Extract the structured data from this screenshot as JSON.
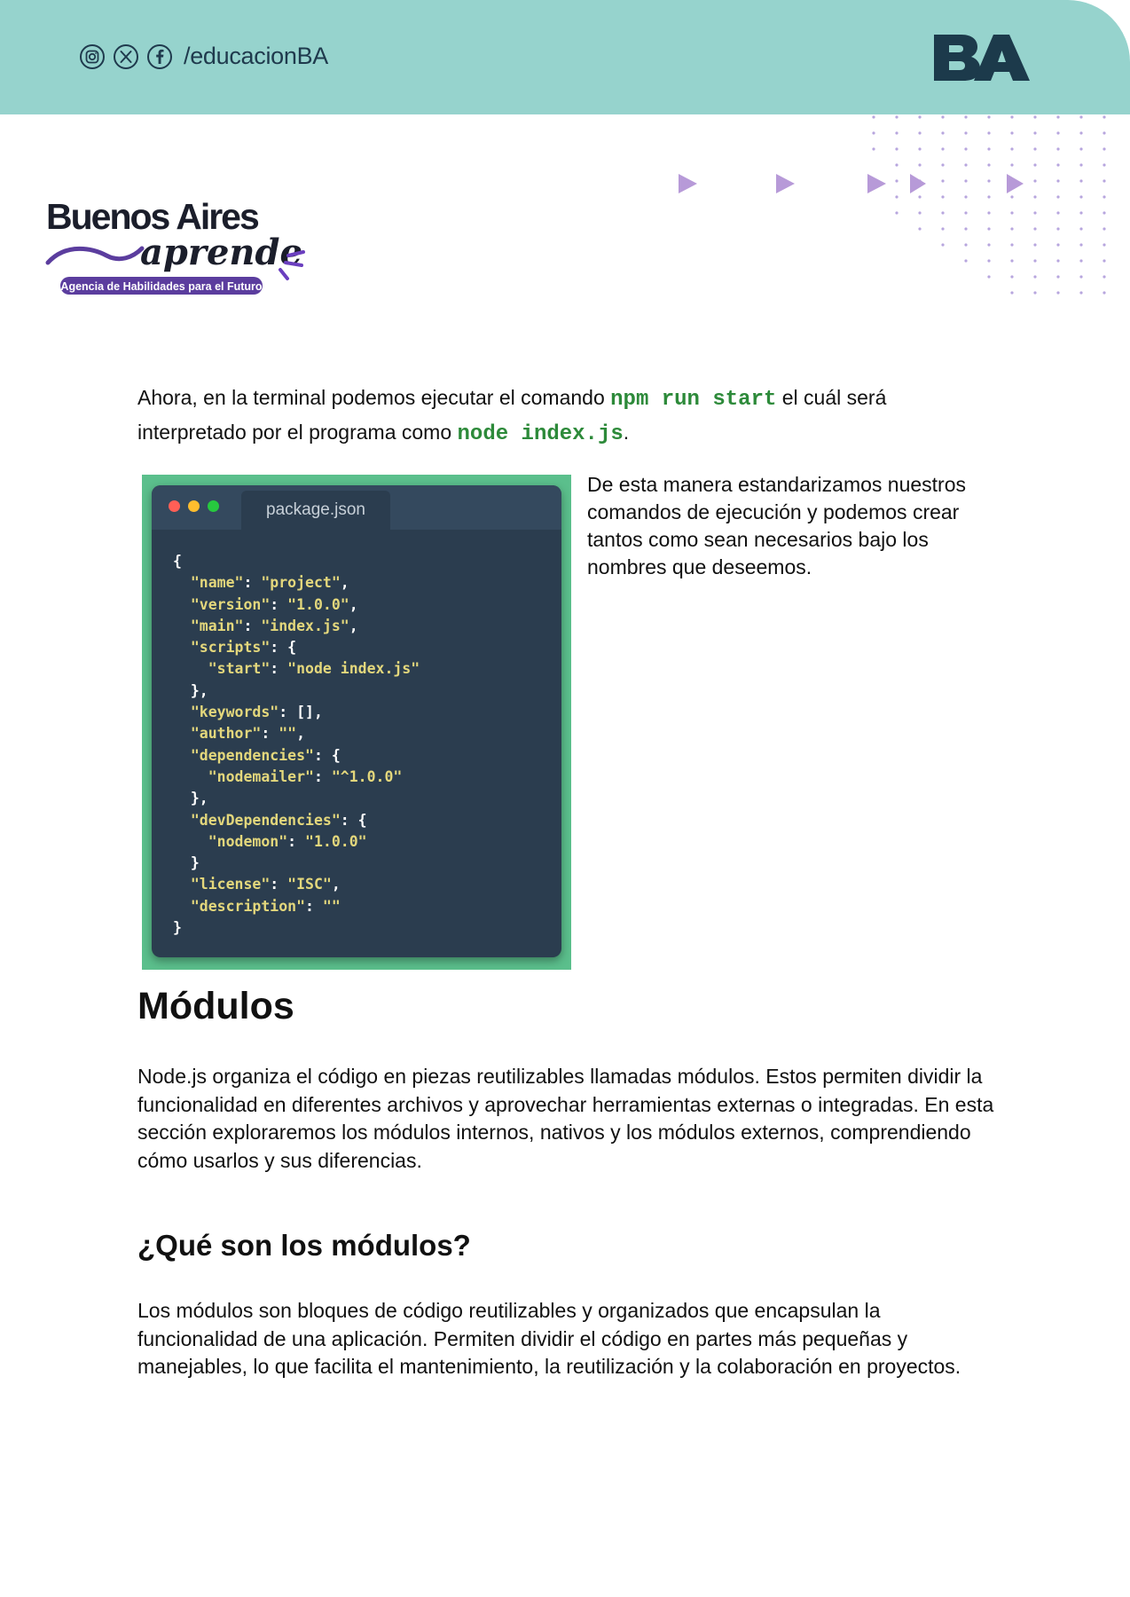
{
  "header": {
    "handle": "/educacionBA",
    "logo_text": "BA",
    "colors": {
      "band": "#96d3cd",
      "ink": "#1f3a4d"
    },
    "icons": [
      "instagram-icon",
      "x-icon",
      "facebook-icon"
    ]
  },
  "brand": {
    "line1": "Buenos Aires",
    "line2": "aprende",
    "tagline": "Agencia de Habilidades para el Futuro"
  },
  "intro": {
    "t1": "Ahora, en la terminal podemos ejecutar el comando ",
    "cmd1": "npm run start",
    "t2": " el cuál será interpretado por el programa como ",
    "cmd2": "node index.js",
    "t3": "."
  },
  "screenshot": {
    "tab_label": "package.json",
    "code_lines": [
      "{",
      "  \"name\": \"project\",",
      "  \"version\": \"1.0.0\",",
      "  \"main\": \"index.js\",",
      "  \"scripts\": {",
      "    \"start\": \"node index.js\"",
      "  },",
      "  \"keywords\": [],",
      "  \"author\": \"\",",
      "  \"dependencies\": {",
      "    \"nodemailer\": \"^1.0.0\"",
      "  },",
      "  \"devDependencies\": {",
      "    \"nodemon\": \"1.0.0\"",
      "  }",
      "  \"license\": \"ISC\",",
      "  \"description\": \"\"",
      "}"
    ]
  },
  "side_text": "De esta manera estandarizamos nuestros comandos de ejecución y podemos crear tantos como sean necesarios bajo los nombres que deseemos.",
  "section1": {
    "title": "Módulos",
    "body": "Node.js organiza el código en piezas reutilizables llamadas módulos. Estos permiten dividir la funcionalidad en diferentes archivos y aprovechar herramientas externas o integradas. En esta sección exploraremos los módulos internos, nativos y los módulos externos, comprendiendo cómo usarlos y sus diferencias."
  },
  "section2": {
    "title": "¿Qué son los módulos?",
    "body": "Los módulos son bloques de código reutilizables y organizados que encapsulan la funcionalidad de una aplicación. Permiten dividir el código en partes más pequeñas y manejables, lo que facilita el mantenimiento, la reutilización y la colaboración en proyectos."
  }
}
